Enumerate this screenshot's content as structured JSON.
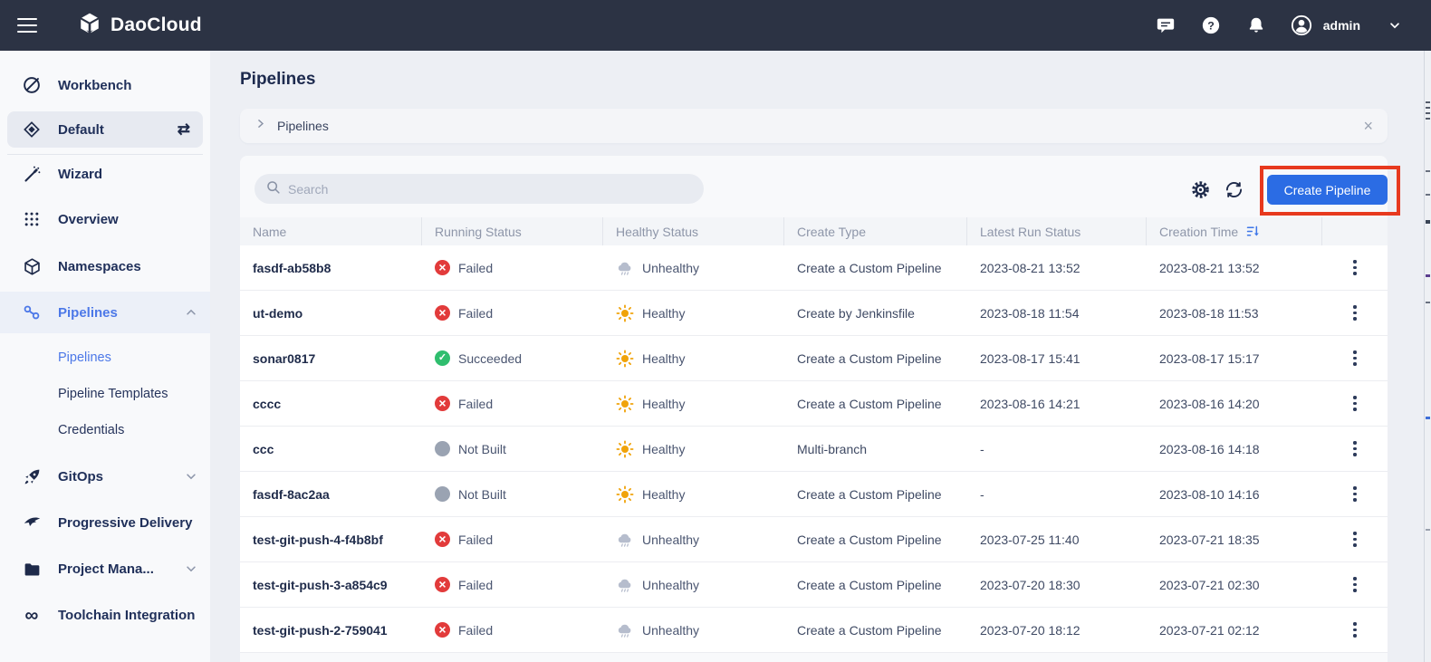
{
  "topbar": {
    "brand": "DaoCloud",
    "username": "admin"
  },
  "sidebar": {
    "items": [
      {
        "label": "Workbench"
      },
      {
        "label": "Default"
      },
      {
        "label": "Wizard"
      },
      {
        "label": "Overview"
      },
      {
        "label": "Namespaces"
      },
      {
        "label": "Pipelines"
      },
      {
        "label": "Pipelines"
      },
      {
        "label": "Pipeline Templates"
      },
      {
        "label": "Credentials"
      },
      {
        "label": "GitOps"
      },
      {
        "label": "Progressive Delivery"
      },
      {
        "label": "Project Mana..."
      },
      {
        "label": "Toolchain Integration"
      }
    ]
  },
  "page": {
    "title": "Pipelines",
    "breadcrumb": "Pipelines"
  },
  "toolbar": {
    "search_placeholder": "Search",
    "create_button": "Create Pipeline"
  },
  "colors": {
    "accent_blue": "#2B6CE4",
    "annotation_red": "#E7391E",
    "status_failed": "#E23B3B",
    "status_succeeded": "#2FBE6E",
    "status_not_built": "#9AA3B2",
    "healthy_sun": "#F0A30A",
    "unhealthy_cloud": "#B6BDCD",
    "topbar_bg": "#2C3344",
    "sidebar_active": "#4C78E8"
  },
  "table": {
    "columns": [
      "Name",
      "Running Status",
      "Healthy Status",
      "Create Type",
      "Latest Run Status",
      "Creation Time",
      ""
    ],
    "rows": [
      {
        "name": "fasdf-ab58b8",
        "running": {
          "label": "Failed",
          "state": "failed"
        },
        "healthy": {
          "label": "Unhealthy",
          "state": "unhealthy"
        },
        "create_type": "Create a Custom Pipeline",
        "latest_run": "2023-08-21 13:52",
        "creation_time": "2023-08-21 13:52"
      },
      {
        "name": "ut-demo",
        "running": {
          "label": "Failed",
          "state": "failed"
        },
        "healthy": {
          "label": "Healthy",
          "state": "healthy"
        },
        "create_type": "Create by Jenkinsfile",
        "latest_run": "2023-08-18 11:54",
        "creation_time": "2023-08-18 11:53"
      },
      {
        "name": "sonar0817",
        "running": {
          "label": "Succeeded",
          "state": "succeeded"
        },
        "healthy": {
          "label": "Healthy",
          "state": "healthy"
        },
        "create_type": "Create a Custom Pipeline",
        "latest_run": "2023-08-17 15:41",
        "creation_time": "2023-08-17 15:17"
      },
      {
        "name": "cccc",
        "running": {
          "label": "Failed",
          "state": "failed"
        },
        "healthy": {
          "label": "Healthy",
          "state": "healthy"
        },
        "create_type": "Create a Custom Pipeline",
        "latest_run": "2023-08-16 14:21",
        "creation_time": "2023-08-16 14:20"
      },
      {
        "name": "ccc",
        "running": {
          "label": "Not Built",
          "state": "notbuilt"
        },
        "healthy": {
          "label": "Healthy",
          "state": "healthy"
        },
        "create_type": "Multi-branch",
        "latest_run": "-",
        "creation_time": "2023-08-16 14:18"
      },
      {
        "name": "fasdf-8ac2aa",
        "running": {
          "label": "Not Built",
          "state": "notbuilt"
        },
        "healthy": {
          "label": "Healthy",
          "state": "healthy"
        },
        "create_type": "Create a Custom Pipeline",
        "latest_run": "-",
        "creation_time": "2023-08-10 14:16"
      },
      {
        "name": "test-git-push-4-f4b8bf",
        "running": {
          "label": "Failed",
          "state": "failed"
        },
        "healthy": {
          "label": "Unhealthy",
          "state": "unhealthy"
        },
        "create_type": "Create a Custom Pipeline",
        "latest_run": "2023-07-25 11:40",
        "creation_time": "2023-07-21 18:35"
      },
      {
        "name": "test-git-push-3-a854c9",
        "running": {
          "label": "Failed",
          "state": "failed"
        },
        "healthy": {
          "label": "Unhealthy",
          "state": "unhealthy"
        },
        "create_type": "Create a Custom Pipeline",
        "latest_run": "2023-07-20 18:30",
        "creation_time": "2023-07-21 02:30"
      },
      {
        "name": "test-git-push-2-759041",
        "running": {
          "label": "Failed",
          "state": "failed"
        },
        "healthy": {
          "label": "Unhealthy",
          "state": "unhealthy"
        },
        "create_type": "Create a Custom Pipeline",
        "latest_run": "2023-07-20 18:12",
        "creation_time": "2023-07-21 02:12"
      }
    ]
  }
}
